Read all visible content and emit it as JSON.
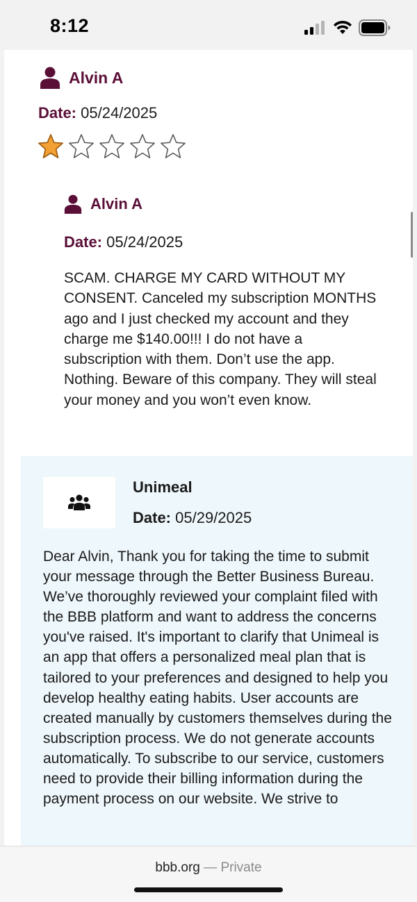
{
  "status_bar": {
    "time": "8:12"
  },
  "review": {
    "reviewer_name": "Alvin A",
    "date_label": "Date:",
    "date_value": "05/24/2025",
    "rating": 1,
    "max_rating": 5,
    "inner_reviewer_name": "Alvin A",
    "inner_date_label": "Date:",
    "inner_date_value": "05/24/2025",
    "text": "SCAM. CHARGE MY CARD WITHOUT MY CONSENT. Canceled my subscription MONTHS ago and I just checked my account and they charge me $140.00!!! I do not have a subscription with them. Don’t use the app. Nothing. Beware of this company. They will steal your money and you won’t even know."
  },
  "response": {
    "business_name": "Unimeal",
    "date_label": "Date:",
    "date_value": "05/29/2025",
    "text": "Dear Alvin, Thank you for taking the time to submit your message through the Better Business Bureau. We’ve thoroughly reviewed your complaint filed with the BBB platform and want to address the concerns you've raised. It's important to clarify that Unimeal is an app that offers a personalized meal plan that is tailored to your preferences and designed to help you develop healthy eating habits. User accounts are created manually by customers themselves during the subscription process. We do not generate accounts automatically. To subscribe to our service, customers need to provide their billing information during the payment process on our website. We strive to"
  },
  "browser": {
    "domain": "bbb.org",
    "separator": " — ",
    "mode": "Private"
  },
  "colors": {
    "brand_maroon": "#5a0f37",
    "star_filled": "#f2a033",
    "response_bg": "#eef7fb"
  }
}
